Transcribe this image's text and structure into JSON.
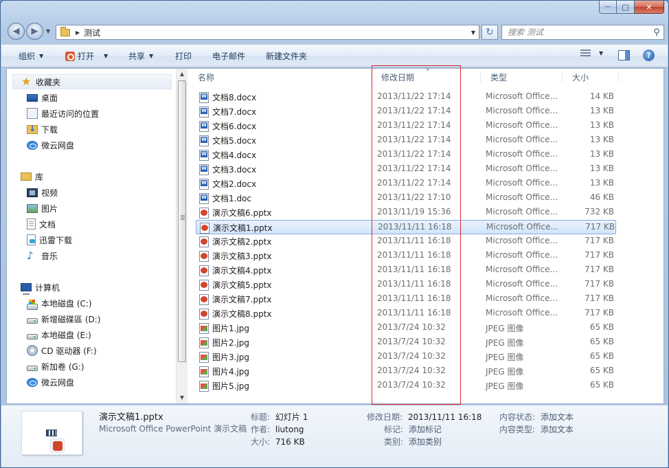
{
  "window": {
    "caption": {
      "minimize": "—",
      "maximize": "□",
      "close": "✕"
    }
  },
  "nav": {
    "back_icon": "◀",
    "forward_icon": "▶",
    "dropdown_icon": "▼",
    "path_separator": "▶",
    "path": "测试",
    "address_dropdown": "▼",
    "refresh_icon": "↻",
    "search_placeholder": "搜索 测试",
    "search_icon": "⚲"
  },
  "toolbar": {
    "organize": "组织",
    "open": "打开",
    "share": "共享",
    "print": "打印",
    "email": "电子邮件",
    "new_folder": "新建文件夹",
    "arrow": "▼",
    "view_arrow": "▼",
    "help": "?"
  },
  "sidebar": {
    "favorites": {
      "label": "收藏夹",
      "items": [
        "桌面",
        "最近访问的位置",
        "下载",
        "微云网盘"
      ]
    },
    "libraries": {
      "label": "库",
      "items": [
        "视频",
        "图片",
        "文档",
        "迅雷下载",
        "音乐"
      ]
    },
    "computer": {
      "label": "计算机",
      "items": [
        "本地磁盘 (C:)",
        "新增磁碟區 (D:)",
        "本地磁盘 (E:)",
        "CD 驱动器 (F:)",
        "新加卷 (G:)",
        "微云网盘"
      ]
    }
  },
  "scrollbar": {
    "up": "▲",
    "down": "▼"
  },
  "columns": {
    "name": "名称",
    "date": "修改日期",
    "type": "类型",
    "size": "大小",
    "sort_indicator": "▼"
  },
  "files": [
    {
      "name": "文档8.docx",
      "date": "2013/11/22 17:14",
      "type": "Microsoft Office...",
      "size": "14 KB",
      "kind": "word"
    },
    {
      "name": "文档7.docx",
      "date": "2013/11/22 17:14",
      "type": "Microsoft Office...",
      "size": "13 KB",
      "kind": "word"
    },
    {
      "name": "文档6.docx",
      "date": "2013/11/22 17:14",
      "type": "Microsoft Office...",
      "size": "13 KB",
      "kind": "word"
    },
    {
      "name": "文档5.docx",
      "date": "2013/11/22 17:14",
      "type": "Microsoft Office...",
      "size": "13 KB",
      "kind": "word"
    },
    {
      "name": "文档4.docx",
      "date": "2013/11/22 17:14",
      "type": "Microsoft Office...",
      "size": "13 KB",
      "kind": "word"
    },
    {
      "name": "文档3.docx",
      "date": "2013/11/22 17:14",
      "type": "Microsoft Office...",
      "size": "13 KB",
      "kind": "word"
    },
    {
      "name": "文档2.docx",
      "date": "2013/11/22 17:14",
      "type": "Microsoft Office...",
      "size": "13 KB",
      "kind": "word"
    },
    {
      "name": "文档1.doc",
      "date": "2013/11/22 17:10",
      "type": "Microsoft Office...",
      "size": "46 KB",
      "kind": "word"
    },
    {
      "name": "演示文稿6.pptx",
      "date": "2013/11/19 15:36",
      "type": "Microsoft Office...",
      "size": "732 KB",
      "kind": "ppt"
    },
    {
      "name": "演示文稿1.pptx",
      "date": "2013/11/11 16:18",
      "type": "Microsoft Office...",
      "size": "717 KB",
      "kind": "ppt",
      "selected": true
    },
    {
      "name": "演示文稿2.pptx",
      "date": "2013/11/11 16:18",
      "type": "Microsoft Office...",
      "size": "717 KB",
      "kind": "ppt"
    },
    {
      "name": "演示文稿3.pptx",
      "date": "2013/11/11 16:18",
      "type": "Microsoft Office...",
      "size": "717 KB",
      "kind": "ppt"
    },
    {
      "name": "演示文稿4.pptx",
      "date": "2013/11/11 16:18",
      "type": "Microsoft Office...",
      "size": "717 KB",
      "kind": "ppt"
    },
    {
      "name": "演示文稿5.pptx",
      "date": "2013/11/11 16:18",
      "type": "Microsoft Office...",
      "size": "717 KB",
      "kind": "ppt"
    },
    {
      "name": "演示文稿7.pptx",
      "date": "2013/11/11 16:18",
      "type": "Microsoft Office...",
      "size": "717 KB",
      "kind": "ppt"
    },
    {
      "name": "演示文稿8.pptx",
      "date": "2013/11/11 16:18",
      "type": "Microsoft Office...",
      "size": "717 KB",
      "kind": "ppt"
    },
    {
      "name": "图片1.jpg",
      "date": "2013/7/24 10:32",
      "type": "JPEG 图像",
      "size": "65 KB",
      "kind": "jpg"
    },
    {
      "name": "图片2.jpg",
      "date": "2013/7/24 10:32",
      "type": "JPEG 图像",
      "size": "65 KB",
      "kind": "jpg"
    },
    {
      "name": "图片3.jpg",
      "date": "2013/7/24 10:32",
      "type": "JPEG 图像",
      "size": "65 KB",
      "kind": "jpg"
    },
    {
      "name": "图片4.jpg",
      "date": "2013/7/24 10:32",
      "type": "JPEG 图像",
      "size": "65 KB",
      "kind": "jpg"
    },
    {
      "name": "图片5.jpg",
      "date": "2013/7/24 10:32",
      "type": "JPEG 图像",
      "size": "65 KB",
      "kind": "jpg"
    }
  ],
  "details": {
    "filename": "演示文稿1.pptx",
    "filetype": "Microsoft Office PowerPoint 演示文稿",
    "title_label": "标题:",
    "title_value": "幻灯片 1",
    "author_label": "作者:",
    "author_value": "liutong",
    "size_label": "大小:",
    "size_value": "716 KB",
    "modified_label": "修改日期:",
    "modified_value": "2013/11/11 16:18",
    "tags_label": "标记:",
    "tags_value": "添加标记",
    "category_label": "类别:",
    "category_value": "添加类别",
    "content_status_label": "内容状态:",
    "content_status_value": "添加文本",
    "content_type_label": "内容类型:",
    "content_type_value": "添加文本"
  },
  "colors": {
    "highlight_box": "#d9272b",
    "selection_border": "#84acdd"
  }
}
